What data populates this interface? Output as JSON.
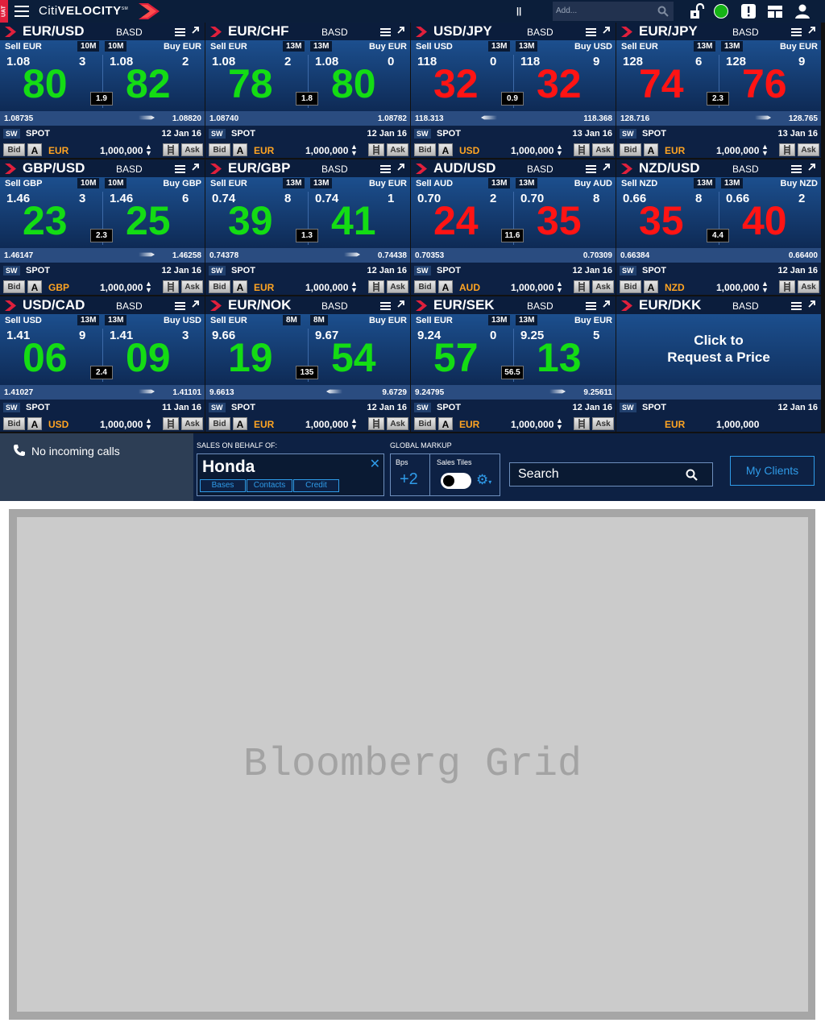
{
  "topbar": {
    "env_badge": "UAT",
    "logo": {
      "prefix": "Citi",
      "main": "VELOCITY",
      "mark": "SM"
    },
    "add_placeholder": "Add..."
  },
  "tiles": [
    {
      "pair": "EUR/USD",
      "mode": "BASD",
      "sell": "Sell EUR",
      "buy": "Buy EUR",
      "sell_amt": "10M",
      "buy_amt": "10M",
      "sell_big": "1.08",
      "buy_big": "1.08",
      "sell_pip": "80",
      "buy_pip": "82",
      "sell_frac": "3",
      "buy_frac": "2",
      "spread": "1.9",
      "color": "green",
      "low": "1.08735",
      "high": "1.08820",
      "arrow": "right",
      "tenor": "SPOT",
      "date": "12 Jan 16",
      "ccy": "EUR",
      "notional": "1,000,000"
    },
    {
      "pair": "EUR/CHF",
      "mode": "BASD",
      "sell": "Sell EUR",
      "buy": "Buy EUR",
      "sell_amt": "13M",
      "buy_amt": "13M",
      "sell_big": "1.08",
      "buy_big": "1.08",
      "sell_pip": "78",
      "buy_pip": "80",
      "sell_frac": "2",
      "buy_frac": "0",
      "spread": "1.8",
      "color": "green",
      "low": "1.08740",
      "high": "1.08782",
      "arrow": "none",
      "tenor": "SPOT",
      "date": "12 Jan 16",
      "ccy": "EUR",
      "notional": "1,000,000"
    },
    {
      "pair": "USD/JPY",
      "mode": "BASD",
      "sell": "Sell USD",
      "buy": "Buy USD",
      "sell_amt": "13M",
      "buy_amt": "13M",
      "sell_big": "118",
      "buy_big": "118",
      "sell_pip": "32",
      "buy_pip": "32",
      "sell_frac": "0",
      "buy_frac": "9",
      "spread": "0.9",
      "color": "red",
      "low": "118.313",
      "high": "118.368",
      "arrow": "left",
      "tenor": "SPOT",
      "date": "13 Jan 16",
      "ccy": "USD",
      "notional": "1,000,000"
    },
    {
      "pair": "EUR/JPY",
      "mode": "BASD",
      "sell": "Sell EUR",
      "buy": "Buy EUR",
      "sell_amt": "13M",
      "buy_amt": "13M",
      "sell_big": "128",
      "buy_big": "128",
      "sell_pip": "74",
      "buy_pip": "76",
      "sell_frac": "6",
      "buy_frac": "9",
      "spread": "2.3",
      "color": "red",
      "low": "128.716",
      "high": "128.765",
      "arrow": "right",
      "tenor": "SPOT",
      "date": "13 Jan 16",
      "ccy": "EUR",
      "notional": "1,000,000"
    },
    {
      "pair": "GBP/USD",
      "mode": "BASD",
      "sell": "Sell GBP",
      "buy": "Buy GBP",
      "sell_amt": "10M",
      "buy_amt": "10M",
      "sell_big": "1.46",
      "buy_big": "1.46",
      "sell_pip": "23",
      "buy_pip": "25",
      "sell_frac": "3",
      "buy_frac": "6",
      "spread": "2.3",
      "color": "green",
      "low": "1.46147",
      "high": "1.46258",
      "arrow": "right",
      "tenor": "SPOT",
      "date": "12 Jan 16",
      "ccy": "GBP",
      "notional": "1,000,000"
    },
    {
      "pair": "EUR/GBP",
      "mode": "BASD",
      "sell": "Sell EUR",
      "buy": "Buy EUR",
      "sell_amt": "13M",
      "buy_amt": "13M",
      "sell_big": "0.74",
      "buy_big": "0.74",
      "sell_pip": "39",
      "buy_pip": "41",
      "sell_frac": "8",
      "buy_frac": "1",
      "spread": "1.3",
      "color": "green",
      "low": "0.74378",
      "high": "0.74438",
      "arrow": "right",
      "tenor": "SPOT",
      "date": "12 Jan 16",
      "ccy": "EUR",
      "notional": "1,000,000"
    },
    {
      "pair": "AUD/USD",
      "mode": "BASD",
      "sell": "Sell AUD",
      "buy": "Buy AUD",
      "sell_amt": "13M",
      "buy_amt": "13M",
      "sell_big": "0.70",
      "buy_big": "0.70",
      "sell_pip": "24",
      "buy_pip": "35",
      "sell_frac": "2",
      "buy_frac": "8",
      "spread": "11.6",
      "color": "red",
      "low": "0.70353",
      "high": "0.70309",
      "arrow": "none",
      "tenor": "SPOT",
      "date": "12 Jan 16",
      "ccy": "AUD",
      "notional": "1,000,000"
    },
    {
      "pair": "NZD/USD",
      "mode": "BASD",
      "sell": "Sell NZD",
      "buy": "Buy NZD",
      "sell_amt": "13M",
      "buy_amt": "13M",
      "sell_big": "0.66",
      "buy_big": "0.66",
      "sell_pip": "35",
      "buy_pip": "40",
      "sell_frac": "8",
      "buy_frac": "2",
      "spread": "4.4",
      "color": "red",
      "low": "0.66384",
      "high": "0.66400",
      "arrow": "none",
      "tenor": "SPOT",
      "date": "12 Jan 16",
      "ccy": "NZD",
      "notional": "1,000,000"
    },
    {
      "pair": "USD/CAD",
      "mode": "BASD",
      "sell": "Sell USD",
      "buy": "Buy USD",
      "sell_amt": "13M",
      "buy_amt": "13M",
      "sell_big": "1.41",
      "buy_big": "1.41",
      "sell_pip": "06",
      "buy_pip": "09",
      "sell_frac": "9",
      "buy_frac": "3",
      "spread": "2.4",
      "color": "green",
      "low": "1.41027",
      "high": "1.41101",
      "arrow": "right",
      "tenor": "SPOT",
      "date": "11 Jan 16",
      "ccy": "USD",
      "notional": "1,000,000"
    },
    {
      "pair": "EUR/NOK",
      "mode": "BASD",
      "sell": "Sell EUR",
      "buy": "Buy EUR",
      "sell_amt": "8M",
      "buy_amt": "8M",
      "sell_big": "9.66",
      "buy_big": "9.67",
      "sell_pip": "19",
      "buy_pip": "54",
      "sell_frac": "",
      "buy_frac": "",
      "spread": "135",
      "color": "green",
      "low": "9.6613",
      "high": "9.6729",
      "arrow": "left",
      "tenor": "SPOT",
      "date": "12 Jan 16",
      "ccy": "EUR",
      "notional": "1,000,000"
    },
    {
      "pair": "EUR/SEK",
      "mode": "BASD",
      "sell": "Sell EUR",
      "buy": "Buy EUR",
      "sell_amt": "13M",
      "buy_amt": "13M",
      "sell_big": "9.24",
      "buy_big": "9.25",
      "sell_pip": "57",
      "buy_pip": "13",
      "sell_frac": "0",
      "buy_frac": "5",
      "spread": "56.5",
      "color": "green",
      "low": "9.24795",
      "high": "9.25611",
      "arrow": "right",
      "tenor": "SPOT",
      "date": "12 Jan 16",
      "ccy": "EUR",
      "notional": "1,000,000"
    }
  ],
  "request_tile": {
    "pair": "EUR/DKK",
    "mode": "BASD",
    "message_line1": "Click to",
    "message_line2": "Request a Price",
    "tenor": "SPOT",
    "date": "12 Jan 16",
    "ccy": "EUR",
    "notional": "1,000,000"
  },
  "tile_labels": {
    "sw": "SW",
    "bid": "Bid",
    "ask": "Ask",
    "a": "A"
  },
  "bottom": {
    "calls": "No incoming calls",
    "sales_label": "SALES ON BEHALF OF:",
    "client_name": "Honda",
    "client_tabs": [
      "Bases",
      "Contacts",
      "Credit"
    ],
    "markup_label": "GLOBAL MARKUP",
    "bps_label": "Bps",
    "bps_value": "+2",
    "sales_tiles_label": "Sales Tiles",
    "sales_tiles_on": false,
    "search_placeholder": "Search",
    "my_clients": "My Clients"
  },
  "bloomberg": {
    "title": "Bloomberg Grid"
  },
  "colors": {
    "bid_up": "#14dc14",
    "bid_down": "#ff1414",
    "ccy": "#ffa422",
    "accent": "#2f9be8",
    "status_online": "#16b316"
  }
}
